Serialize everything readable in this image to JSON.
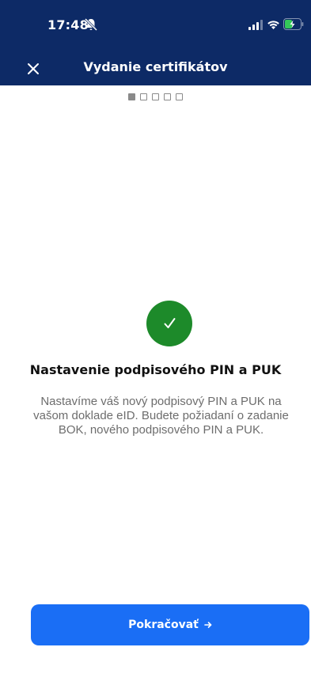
{
  "status_bar": {
    "time": "17:48",
    "icons": [
      "bell-slash-icon",
      "signal-icon",
      "wifi-icon",
      "battery-charging-icon"
    ]
  },
  "nav": {
    "title": "Vydanie certifikátov",
    "close_icon": "close-icon"
  },
  "stepper": {
    "total_steps": 5,
    "current_step": 1
  },
  "content": {
    "icon": "checkmark-icon",
    "title": "Nastavenie podpisového PIN a PUK",
    "description": "Nastavíme váš nový podpisový PIN a PUK na vašom doklade eID. Budete požiadaní o zadanie BOK, nového podpisového PIN a PUK."
  },
  "actions": {
    "continue_label": "Pokračovať",
    "continue_icon": "arrow-right-icon"
  },
  "colors": {
    "header_bg": "#0d2a66",
    "success": "#1d8a2a",
    "primary": "#1a6ef5",
    "text_muted": "#6d6d6d"
  }
}
